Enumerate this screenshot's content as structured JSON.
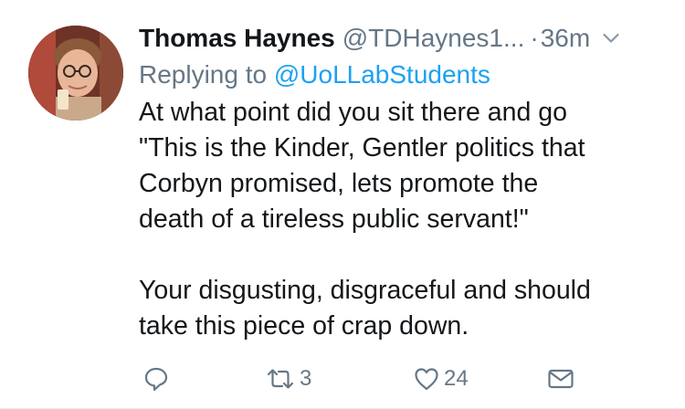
{
  "tweet": {
    "author": {
      "display_name": "Thomas Haynes",
      "handle": "@TDHaynes1...",
      "avatar_icon": "user-avatar-photo"
    },
    "separator": "·",
    "timestamp": "36m",
    "replying_prefix": "Replying to",
    "replying_to": "@UoLLabStudents",
    "body_lines": [
      "At what point did you sit there and go",
      "\"This is the Kinder, Gentler politics that",
      "Corbyn promised, lets promote the",
      "death of a tireless public servant!\""
    ],
    "body_lines_2": [
      "Your disgusting, disgraceful and should",
      "take this piece of crap down."
    ],
    "actions": {
      "reply": {
        "icon": "reply-icon",
        "count": ""
      },
      "retweet": {
        "icon": "retweet-icon",
        "count": "3"
      },
      "like": {
        "icon": "heart-icon",
        "count": "24"
      },
      "dm": {
        "icon": "envelope-icon"
      }
    },
    "colors": {
      "primary_text": "#14171a",
      "secondary_text": "#657786",
      "mention": "#1da1f2"
    }
  }
}
